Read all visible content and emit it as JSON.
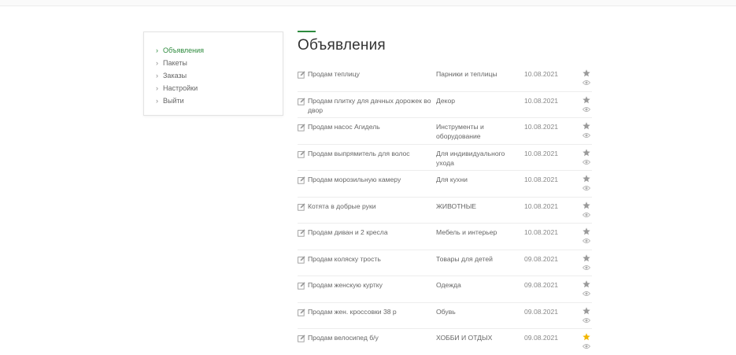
{
  "sidebar": {
    "items": [
      {
        "label": "Объявления",
        "active": true
      },
      {
        "label": "Пакеты",
        "active": false
      },
      {
        "label": "Заказы",
        "active": false
      },
      {
        "label": "Настройки",
        "active": false
      },
      {
        "label": "Выйти",
        "active": false
      }
    ]
  },
  "main": {
    "title": "Объявления",
    "accent_color": "#2e8b3e",
    "ads": [
      {
        "title": "Продам теплицу",
        "category": "Парники и теплицы",
        "date": "10.08.2021",
        "starred": false
      },
      {
        "title": "Продам плитку для дачных дорожек во двор",
        "category": "Декор",
        "date": "10.08.2021",
        "starred": false
      },
      {
        "title": "Продам насос Агидель",
        "category": "Инструменты и оборудование",
        "date": "10.08.2021",
        "starred": false
      },
      {
        "title": "Продам выпрямитель для волос",
        "category": "Для индивидуального ухода",
        "date": "10.08.2021",
        "starred": false
      },
      {
        "title": "Продам морозильную камеру",
        "category": "Для кухни",
        "date": "10.08.2021",
        "starred": false
      },
      {
        "title": "Котята в добрые руки",
        "category": "ЖИВОТНЫЕ",
        "date": "10.08.2021",
        "starred": false
      },
      {
        "title": "Продам диван и 2 кресла",
        "category": "Мебель и интерьер",
        "date": "10.08.2021",
        "starred": false
      },
      {
        "title": "Продам коляску трость",
        "category": "Товары для детей",
        "date": "09.08.2021",
        "starred": false
      },
      {
        "title": "Продам женскую куртку",
        "category": "Одежда",
        "date": "09.08.2021",
        "starred": false
      },
      {
        "title": "Продам жен. кроссовки 38 р",
        "category": "Обувь",
        "date": "09.08.2021",
        "starred": false
      },
      {
        "title": "Продам велосипед б/у",
        "category": "ХОББИ И ОТДЫХ",
        "date": "09.08.2021",
        "starred": true
      }
    ],
    "icons": {
      "edit": "edit-icon",
      "star": "star-icon",
      "view": "eye-icon"
    },
    "colors": {
      "star_default": "#9a9a9a",
      "star_active": "#f2b600",
      "eye": "#b0b0b0"
    }
  }
}
